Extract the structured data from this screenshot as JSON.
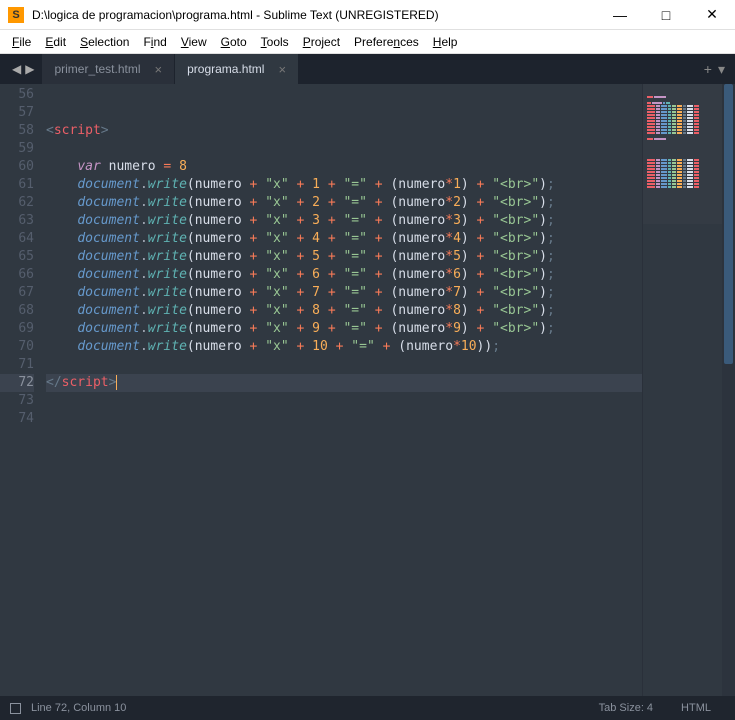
{
  "titlebar": {
    "title": "D:\\logica de programacion\\programa.html - Sublime Text (UNREGISTERED)"
  },
  "menu": {
    "items": [
      {
        "u": "F",
        "rest": "ile"
      },
      {
        "u": "E",
        "rest": "dit"
      },
      {
        "u": "S",
        "rest": "election"
      },
      {
        "u": "F",
        "rest": "ind",
        "pre": "",
        "uidx": 0,
        "label": "Find"
      },
      {
        "u": "V",
        "rest": "iew"
      },
      {
        "u": "G",
        "rest": "oto"
      },
      {
        "u": "T",
        "rest": "ools"
      },
      {
        "u": "P",
        "rest": "roject"
      },
      {
        "u": "P",
        "rest": "references",
        "label": "Preferences",
        "uidx": 0
      },
      {
        "u": "H",
        "rest": "elp"
      }
    ],
    "labels": [
      "File",
      "Edit",
      "Selection",
      "Find",
      "View",
      "Goto",
      "Tools",
      "Project",
      "Preferences",
      "Help"
    ]
  },
  "tabs": [
    {
      "label": "primer_test.html",
      "active": false
    },
    {
      "label": "programa.html",
      "active": true
    }
  ],
  "gutter": {
    "start": 56,
    "end": 74,
    "current": 72
  },
  "code": {
    "var_name": "numero",
    "var_value": "8",
    "obj": "document",
    "fn": "write",
    "xstr": "\"x\"",
    "eqstr": "\"=\"",
    "brstr": "\"<br>\"",
    "lines_start": 1,
    "lines_end": 9,
    "line10_num": "10"
  },
  "status": {
    "pos": "Line 72, Column 10",
    "tabsize": "Tab Size: 4",
    "lang": "HTML"
  }
}
